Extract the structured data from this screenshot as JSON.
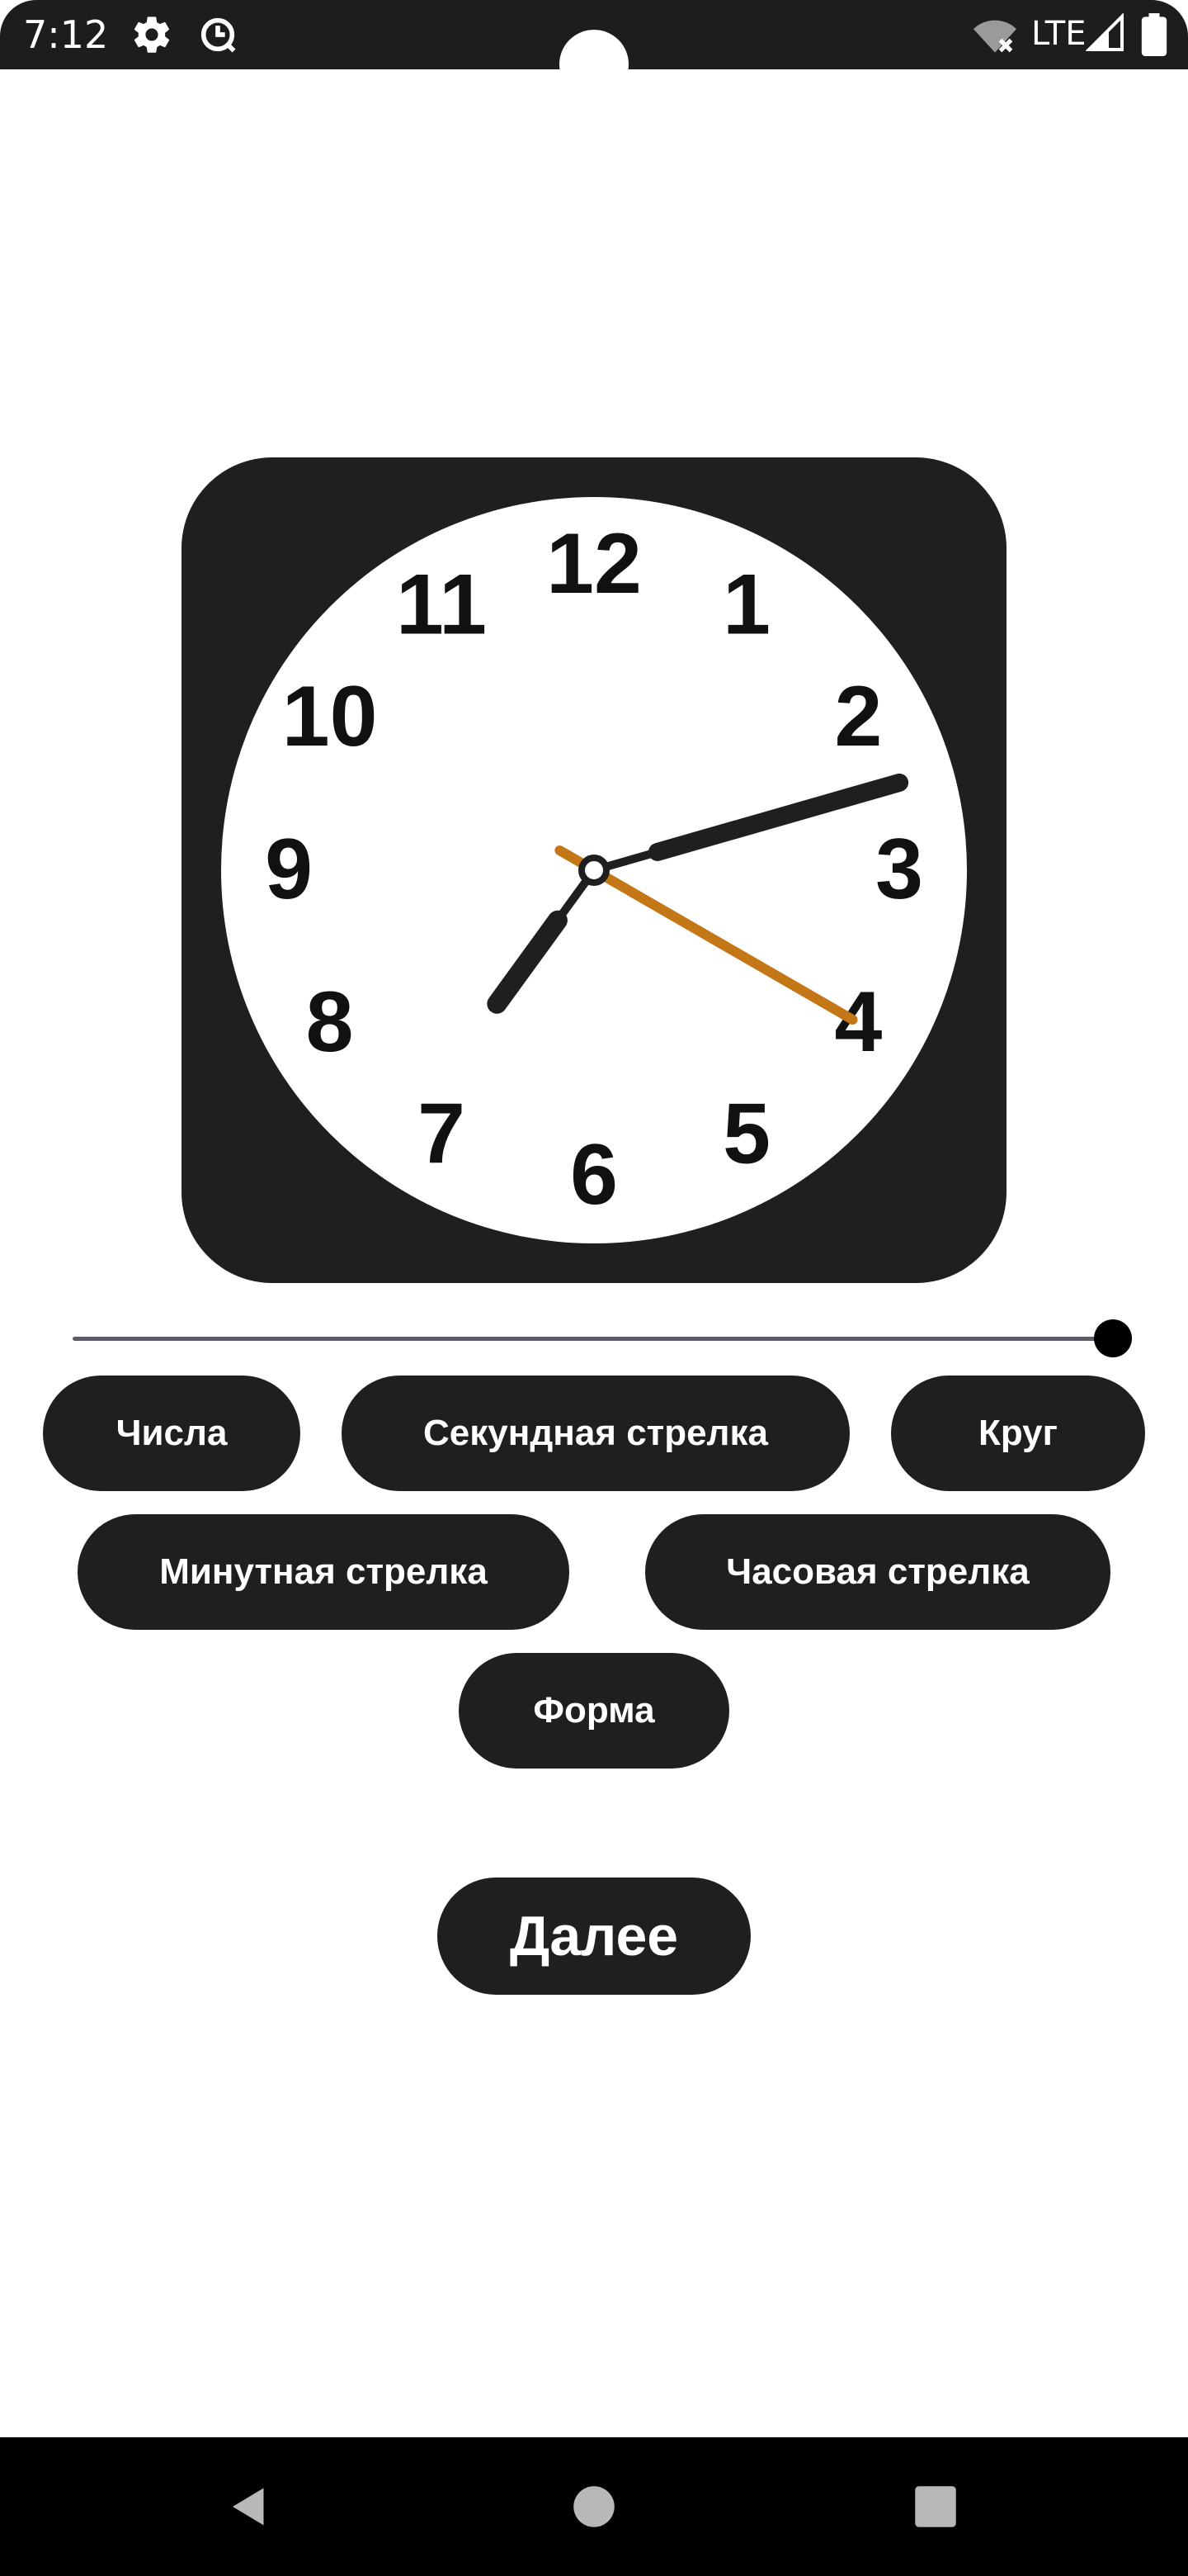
{
  "status_bar": {
    "time": "7:12",
    "network_label": "LTE",
    "icons": [
      "settings-icon",
      "data-saver-icon",
      "wifi-off-icon",
      "signal-icon",
      "battery-icon"
    ]
  },
  "clock": {
    "numerals": [
      "12",
      "1",
      "2",
      "3",
      "4",
      "5",
      "6",
      "7",
      "8",
      "9",
      "10",
      "11"
    ],
    "time_shown": "7:12:20",
    "face_color": "#ffffff",
    "frame_color": "#1f1f1f",
    "hand_color": "#1f1f1f",
    "second_hand_color": "#c47716"
  },
  "slider": {
    "value": 1.0
  },
  "chips": {
    "numbers": "Числа",
    "second_hand": "Секундная стрелка",
    "circle": "Круг",
    "minute_hand": "Минутная стрелка",
    "hour_hand": "Часовая стрелка",
    "shape": "Форма"
  },
  "next_button": "Далее",
  "nav": {
    "icons": [
      "back-icon",
      "home-icon",
      "recents-icon"
    ]
  }
}
